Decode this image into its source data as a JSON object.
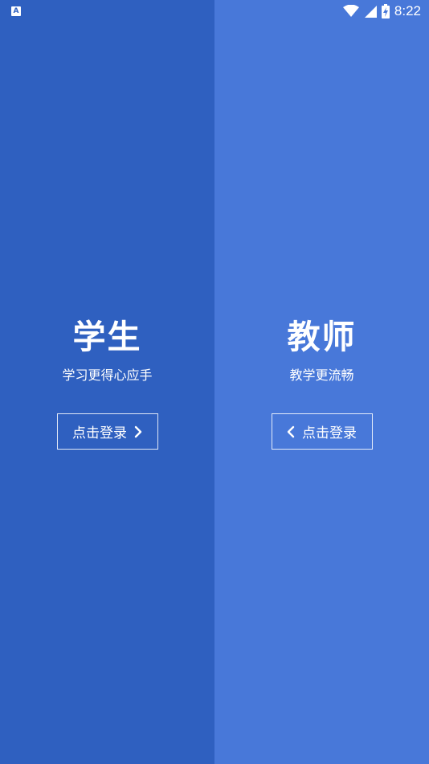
{
  "status_bar": {
    "notification_icon": "text-app-icon",
    "notification_glyph": "A",
    "wifi_icon": "wifi-icon",
    "signal_icon": "cell-signal-icon",
    "battery_icon": "battery-charging-icon",
    "time": "8:22"
  },
  "colors": {
    "left_panel": "#2f60c0",
    "right_panel": "#4878d9",
    "text": "#ffffff"
  },
  "student": {
    "title": "学生",
    "subtitle": "学习更得心应手",
    "button_label": "点击登录",
    "button_icon": "chevron-right-icon"
  },
  "teacher": {
    "title": "教师",
    "subtitle": "教学更流畅",
    "button_label": "点击登录",
    "button_icon": "chevron-left-icon"
  }
}
